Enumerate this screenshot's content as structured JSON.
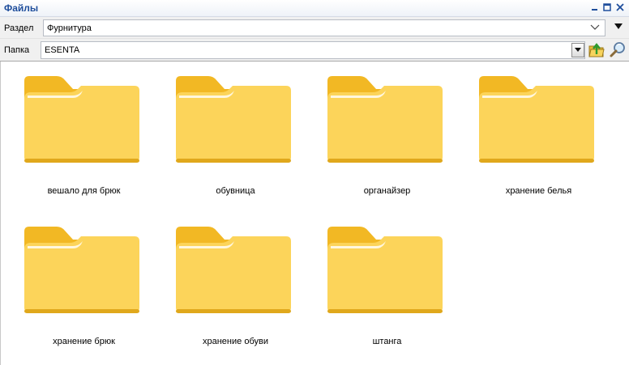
{
  "window": {
    "title": "Файлы"
  },
  "section": {
    "label": "Раздел",
    "value": "Фурнитура"
  },
  "folder_path": {
    "label": "Папка",
    "value": "ESENTA"
  },
  "icons": {
    "folder": "folder-icon",
    "up": "folder-up-icon",
    "search": "magnifier-icon"
  },
  "colors": {
    "title": "#1f4e9c",
    "folder_back": "#f2b824",
    "folder_front": "#fcd45a"
  },
  "folders": [
    {
      "name": "вешало для брюк"
    },
    {
      "name": "обувница"
    },
    {
      "name": "органайзер"
    },
    {
      "name": "хранение белья"
    },
    {
      "name": "хранение брюк"
    },
    {
      "name": "хранение обуви"
    },
    {
      "name": "штанга"
    }
  ]
}
